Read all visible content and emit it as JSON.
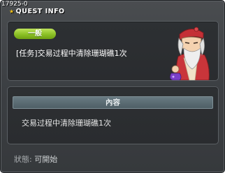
{
  "window": {
    "quest_id": "17925-0",
    "title": "QUEST INFO"
  },
  "quest": {
    "category_badge": "一般",
    "name": "[任务]交易过程中清除珊瑚礁1次"
  },
  "content": {
    "header": "內容",
    "description": "交易过程中清除珊瑚礁1次"
  },
  "status": {
    "label": "狀態:",
    "value": "可開始"
  },
  "npc": {
    "icon": "npc-scholar-portrait"
  },
  "colors": {
    "badge_green": "#8cc126",
    "title_star": "#f2c21d",
    "header_bar": "#5c6d74",
    "window_bg": "#3d4044"
  }
}
